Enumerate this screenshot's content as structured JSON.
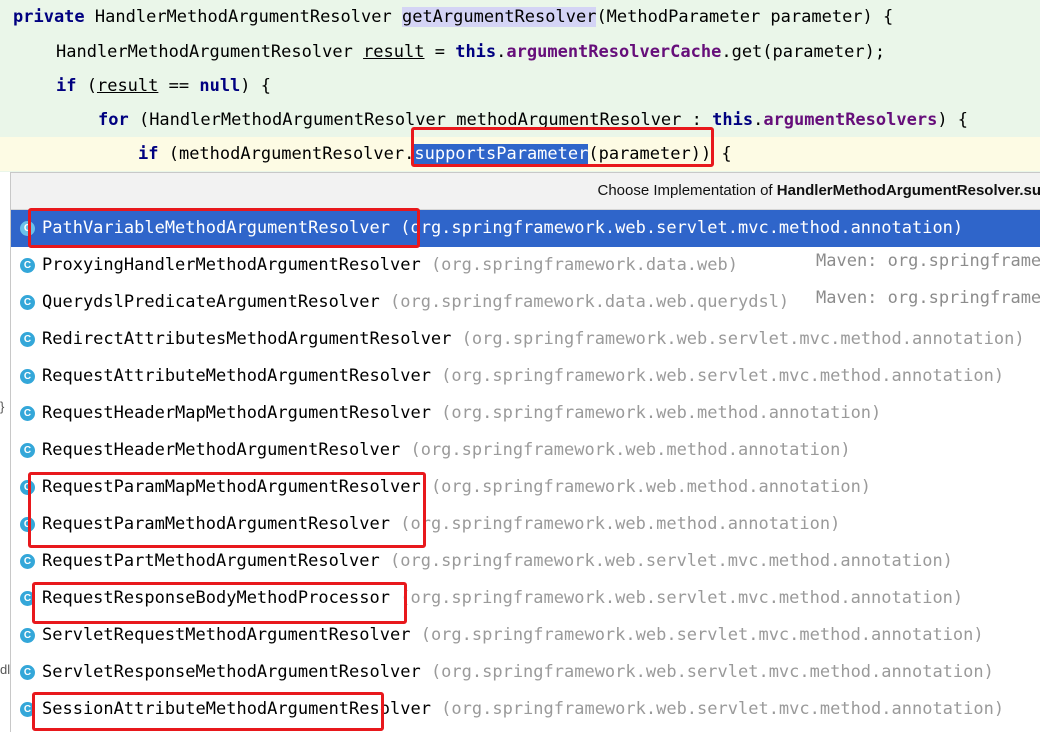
{
  "code": {
    "line1": {
      "kw_private": "private",
      "type": "HandlerMethodArgumentResolver",
      "method": "getArgumentResolver",
      "params": "(MethodParameter parameter) {"
    },
    "line2": {
      "type": "HandlerMethodArgumentResolver",
      "var": "result",
      "eq": " = ",
      "kw_this": "this",
      "dot": ".",
      "field": "argumentResolverCache",
      "rest": ".get(parameter);"
    },
    "line3": {
      "kw_if": "if",
      "open": " (",
      "var": "result",
      "op": " == ",
      "kw_null": "null",
      "close": ") {"
    },
    "line4": {
      "kw_for": "for",
      "decl": " (HandlerMethodArgumentResolver methodArgumentResolver : ",
      "kw_this": "this",
      "dot": ".",
      "field": "argumentResolvers",
      "close": ") {"
    },
    "line5": {
      "kw_if": "if",
      "pre": " (methodArgumentResolver.",
      "method": "supportsParameter",
      "post": "(parameter)) {"
    }
  },
  "popup": {
    "title_prefix": "Choose Implementation of ",
    "title_bold": "HandlerMethodArgumentResolver.su",
    "icon_letter": "C",
    "items": [
      {
        "name": "PathVariableMethodArgumentResolver",
        "pkg": " (org.springframework.web.servlet.mvc.method.annotation)",
        "maven": ""
      },
      {
        "name": "ProxyingHandlerMethodArgumentResolver",
        "pkg": " (org.springframework.data.web)",
        "maven": "Maven: org.springframe"
      },
      {
        "name": "QuerydslPredicateArgumentResolver",
        "pkg": " (org.springframework.data.web.querydsl)",
        "maven": "Maven: org.springframe"
      },
      {
        "name": "RedirectAttributesMethodArgumentResolver",
        "pkg": " (org.springframework.web.servlet.mvc.method.annotation)",
        "maven": ""
      },
      {
        "name": "RequestAttributeMethodArgumentResolver",
        "pkg": " (org.springframework.web.servlet.mvc.method.annotation)",
        "maven": ""
      },
      {
        "name": "RequestHeaderMapMethodArgumentResolver",
        "pkg": " (org.springframework.web.method.annotation)",
        "maven": ""
      },
      {
        "name": "RequestHeaderMethodArgumentResolver",
        "pkg": " (org.springframework.web.method.annotation)",
        "maven": ""
      },
      {
        "name": "RequestParamMapMethodArgumentResolver",
        "pkg": " (org.springframework.web.method.annotation)",
        "maven": ""
      },
      {
        "name": "RequestParamMethodArgumentResolver",
        "pkg": " (org.springframework.web.method.annotation)",
        "maven": ""
      },
      {
        "name": "RequestPartMethodArgumentResolver",
        "pkg": " (org.springframework.web.servlet.mvc.method.annotation)",
        "maven": ""
      },
      {
        "name": "RequestResponseBodyMethodProcessor",
        "pkg": " (org.springframework.web.servlet.mvc.method.annotation)",
        "maven": ""
      },
      {
        "name": "ServletRequestMethodArgumentResolver",
        "pkg": " (org.springframework.web.servlet.mvc.method.annotation)",
        "maven": ""
      },
      {
        "name": "ServletResponseMethodArgumentResolver",
        "pkg": " (org.springframework.web.servlet.mvc.method.annotation)",
        "maven": ""
      },
      {
        "name": "SessionAttributeMethodArgumentResolver",
        "pkg": " (org.springframework.web.servlet.mvc.method.annotation)",
        "maven": ""
      }
    ],
    "selected_index": 0
  },
  "gutter": {
    "brace": "}",
    "fragment": "dl"
  },
  "colors": {
    "code_background": "#eaf6e9",
    "current_line": "#fdfbe4",
    "keyword": "#000080",
    "field": "#660e7a",
    "selection": "#2f65ca",
    "annotation_box": "#e8181c",
    "class_icon": "#34a7d9"
  }
}
